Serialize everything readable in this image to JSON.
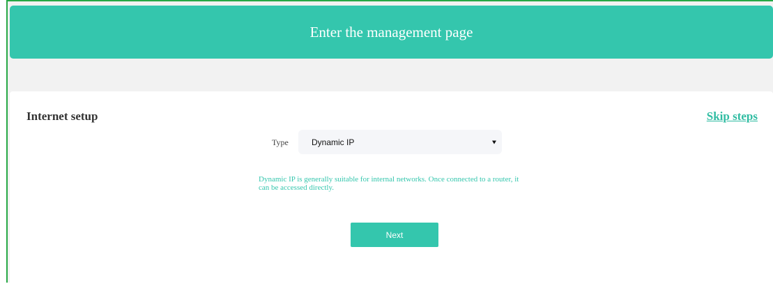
{
  "header": {
    "title": "Enter the management page"
  },
  "setup": {
    "title": "Internet setup",
    "skip_label": "Skip steps",
    "type_label": "Type",
    "type_value": "Dynamic IP",
    "hint": "Dynamic IP is generally suitable for internal networks. Once connected to a router, it can be accessed directly.",
    "next_label": "Next"
  },
  "colors": {
    "accent": "#34c6ad",
    "frame_border": "#27a845",
    "background": "#f2f2f2"
  },
  "icons": {
    "select_arrow": "dropdown-triangle-icon"
  }
}
